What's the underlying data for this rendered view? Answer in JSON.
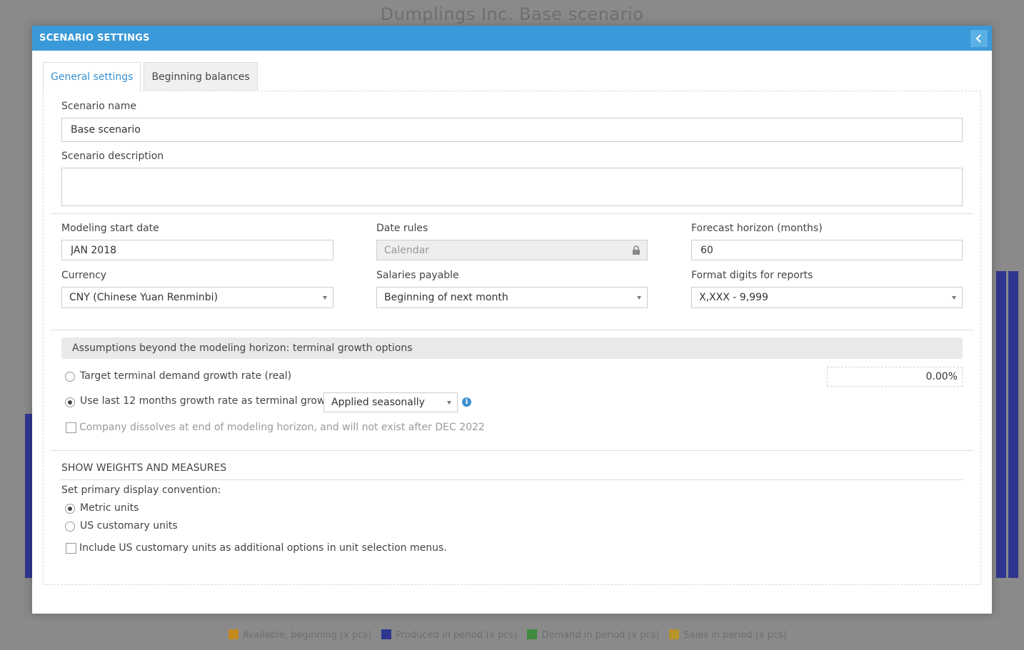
{
  "background": {
    "title": "Dumplings Inc. Base scenario",
    "legend": [
      {
        "label": "Available, beginning (x pcs)",
        "color": "#c48a1d"
      },
      {
        "label": "Produced in period (x pcs)",
        "color": "#2f3690"
      },
      {
        "label": "Demand in period (x pcs)",
        "color": "#3f8a3f"
      },
      {
        "label": "Sales in period (x pcs)",
        "color": "#b8952a"
      }
    ]
  },
  "modal": {
    "title": "SCENARIO SETTINGS",
    "tabs": [
      {
        "label": "General settings",
        "active": true
      },
      {
        "label": "Beginning balances",
        "active": false
      }
    ]
  },
  "form": {
    "scenario_name_label": "Scenario name",
    "scenario_name_value": "Base scenario",
    "scenario_description_label": "Scenario description",
    "scenario_description_value": "",
    "modeling_start_label": "Modeling start date",
    "modeling_start_value": "JAN 2018",
    "date_rules_label": "Date rules",
    "date_rules_value": "Calendar",
    "forecast_horizon_label": "Forecast horizon (months)",
    "forecast_horizon_value": "60",
    "currency_label": "Currency",
    "currency_value": "CNY (Chinese Yuan Renminbi)",
    "salaries_label": "Salaries payable",
    "salaries_value": "Beginning of next month",
    "format_digits_label": "Format digits for reports",
    "format_digits_value": "X,XXX - 9,999"
  },
  "terminal": {
    "section_title": "Assumptions beyond the modeling horizon: terminal growth options",
    "option_target_label": "Target terminal demand growth rate (real)",
    "option_target_value": "0.00%",
    "option_last12_label": "Use last 12 months growth rate as terminal growth",
    "option_last12_select": "Applied seasonally",
    "selected_option": "last12",
    "dissolve_label": "Company dissolves at end of modeling horizon, and will not exist after DEC 2022",
    "dissolve_checked": false
  },
  "weights": {
    "section_title": "SHOW WEIGHTS AND MEASURES",
    "convention_label": "Set primary display convention:",
    "metric_label": "Metric units",
    "us_label": "US customary units",
    "selected": "metric",
    "include_us_label": "Include US customary units as additional options in unit selection menus.",
    "include_us_checked": false
  }
}
